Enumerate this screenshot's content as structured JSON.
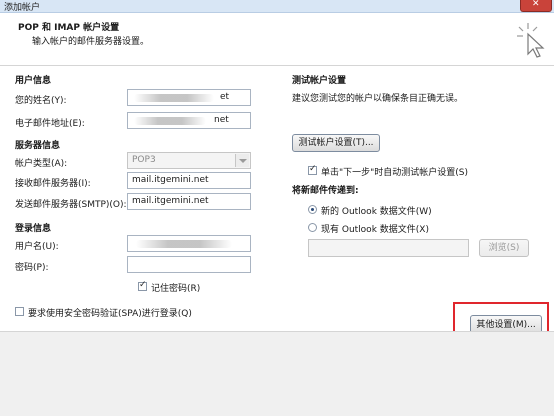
{
  "window": {
    "title": "添加帐户",
    "close_glyph": "✕"
  },
  "header": {
    "title": "POP 和 IMAP 帐户设置",
    "subtitle": "输入帐户的邮件服务器设置。",
    "icon": "cursor-click-icon"
  },
  "user_info": {
    "section": "用户信息",
    "name_label": "您的姓名(Y):",
    "name_value": "et",
    "email_label": "电子邮件地址(E):",
    "email_value": "net"
  },
  "server_info": {
    "section": "服务器信息",
    "account_type_label": "帐户类型(A):",
    "account_type_value": "POP3",
    "incoming_label": "接收邮件服务器(I):",
    "incoming_value": "mail.itgemini.net",
    "outgoing_label": "发送邮件服务器(SMTP)(O):",
    "outgoing_value": "mail.itgemini.net"
  },
  "login_info": {
    "section": "登录信息",
    "username_label": "用户名(U):",
    "password_label": "密码(P):",
    "remember_label": "记住密码(R)",
    "remember_checked": true
  },
  "spa": {
    "label": "要求使用安全密码验证(SPA)进行登录(Q)",
    "checked": false
  },
  "test": {
    "section": "测试帐户设置",
    "description": "建议您测试您的帐户以确保条目正确无误。",
    "button": "测试帐户设置(T)...",
    "auto_test_label": "单击\"下一步\"时自动测试帐户设置(S)",
    "auto_test_checked": true
  },
  "delivery": {
    "section": "将新邮件传递到:",
    "new_file_label": "新的 Outlook 数据文件(W)",
    "existing_file_label": "现有 Outlook 数据文件(X)",
    "selected": "new",
    "browse_button": "浏览(S)"
  },
  "more_settings_button": "其他设置(M)...",
  "colors": {
    "highlight": "#e0262d",
    "titlebar": "#d8e6f5"
  }
}
